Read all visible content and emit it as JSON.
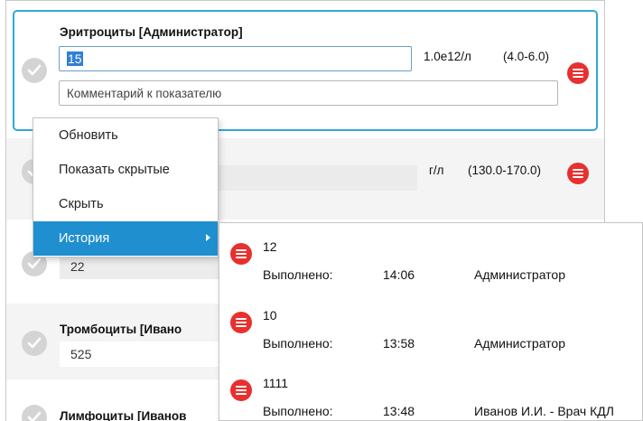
{
  "active_row": {
    "label": "Эритроциты  [Администратор]",
    "value": "15",
    "units": "1.0e12/л",
    "range": "(4.0-6.0)",
    "comment_placeholder": "Комментарий к показателю"
  },
  "row2": {
    "units": "г/л",
    "range": "(130.0-170.0)"
  },
  "row3": {
    "value": "22"
  },
  "row4": {
    "label": "Тромбоциты [Ивано",
    "value": "525"
  },
  "row5": {
    "label": "Лимфоциты [Иванов"
  },
  "context_menu": {
    "items": [
      "Обновить",
      "Показать скрытые",
      "Скрыть",
      "История"
    ]
  },
  "history": {
    "entries": [
      {
        "value": "12",
        "done_label": "Выполнено:",
        "time": "14:06",
        "user": "Администратор"
      },
      {
        "value": "10",
        "done_label": "Выполнено:",
        "time": "13:58",
        "user": "Администратор"
      },
      {
        "value": "1111",
        "done_label": "Выполнено:",
        "time": "13:48",
        "user": "Иванов И.И. - Врач КДЛ"
      }
    ]
  },
  "colors": {
    "accent": "#32a8d8",
    "menu_active": "#1f8fd0",
    "delete_red": "#e8302f",
    "check_grey": "#d4d4d4"
  },
  "icons": [
    "check-circle-icon",
    "delete-circle-icon",
    "chevron-right-icon"
  ]
}
